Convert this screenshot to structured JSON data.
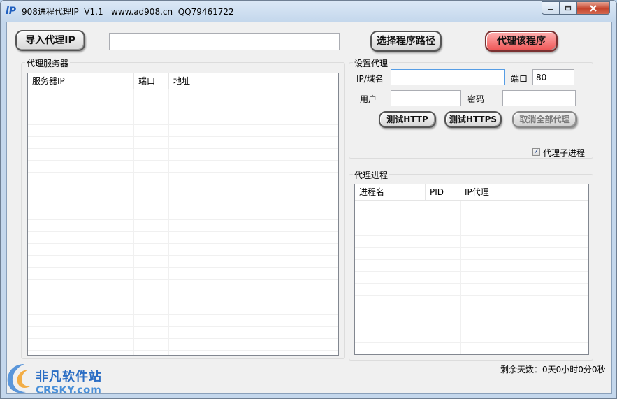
{
  "window": {
    "title": "908进程代理IP  V1.1   www.ad908.cn  QQ79461722",
    "icon_text": "iP",
    "controls": {
      "minimize": "minimize-icon",
      "maximize": "maximize-icon",
      "close": "close-icon"
    }
  },
  "toolbar": {
    "import_label": "导入代理IP",
    "path_value": "",
    "select_path_label": "选择程序路径",
    "proxy_program_label": "代理该程序"
  },
  "proxy_servers": {
    "group_label": "代理服务器",
    "columns": [
      "服务器IP",
      "端口",
      "地址"
    ],
    "rows": []
  },
  "settings": {
    "group_label": "设置代理",
    "ip_label": "IP/域名",
    "ip_value": "",
    "port_label": "端口",
    "port_value": "80",
    "user_label": "用户",
    "user_value": "",
    "password_label": "密码",
    "password_value": "",
    "test_http_label": "测试HTTP",
    "test_https_label": "测试HTTPS",
    "cancel_all_label": "取消全部代理",
    "child_process_label": "代理子进程",
    "child_process_checked": "✓"
  },
  "processes": {
    "group_label": "代理进程",
    "columns": [
      "进程名",
      "PID",
      "IP代理"
    ],
    "rows": []
  },
  "status": {
    "remaining": "剩余天数：0天0小时0分0秒"
  },
  "watermark": {
    "cn": "非凡软件站",
    "en": "CRSKY.com"
  },
  "colors": {
    "accent_red": "#ee5555",
    "title_bar": "#c4d7ec",
    "watermark_blue": "#2a6dc4"
  }
}
